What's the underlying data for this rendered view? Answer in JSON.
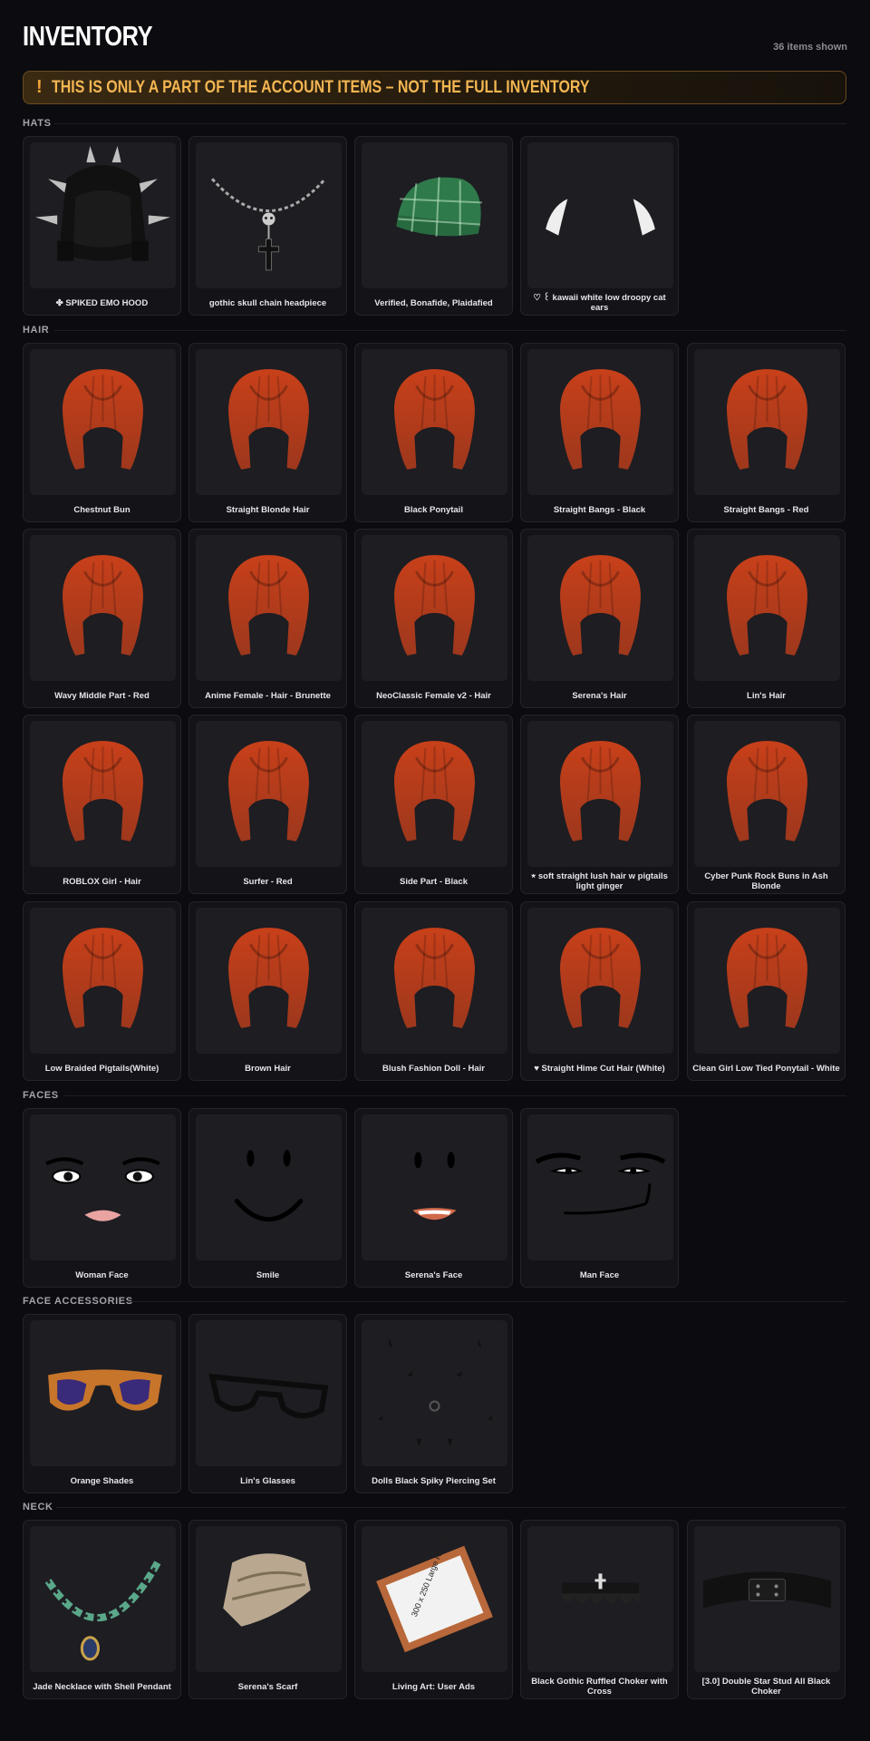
{
  "header": {
    "title": "INVENTORY",
    "count": "36 items shown"
  },
  "banner": {
    "icon": "!",
    "text": "THIS IS ONLY A PART OF THE ACCOUNT ITEMS – NOT THE FULL INVENTORY"
  },
  "sections": {
    "hats": {
      "label": "HATS",
      "items": [
        {
          "name": "✤ SPIKED EMO HOOD",
          "icon": "spiked-hood-icon"
        },
        {
          "name": "gothic skull chain headpiece",
          "icon": "skull-chain-icon"
        },
        {
          "name": "Verified, Bonafide, Plaidafied",
          "icon": "plaid-cap-icon"
        },
        {
          "name": "♡ ꒰ kawaii white low droopy cat ears",
          "icon": "cat-ears-icon"
        }
      ]
    },
    "hair": {
      "label": "HAIR",
      "items": [
        {
          "name": "Chestnut Bun",
          "icon": "hair-icon",
          "color": "#c8401a"
        },
        {
          "name": "Straight Blonde Hair",
          "icon": "hair-icon",
          "color": "#d9b441"
        },
        {
          "name": "Black Ponytail",
          "icon": "hair-icon",
          "color": "#1a1a1e"
        },
        {
          "name": "Straight Bangs - Black",
          "icon": "hair-icon",
          "color": "#2a2a2c"
        },
        {
          "name": "Straight Bangs - Red",
          "icon": "hair-icon",
          "color": "#7a3a22"
        },
        {
          "name": "Wavy Middle Part - Red",
          "icon": "hair-icon",
          "color": "#8a3f22"
        },
        {
          "name": "Anime Female - Hair - Brunette",
          "icon": "hair-icon",
          "color": "#5a2e1a"
        },
        {
          "name": "NeoClassic Female v2 - Hair",
          "icon": "hair-icon",
          "color": "#2a2623"
        },
        {
          "name": "Serena's Hair",
          "icon": "hair-icon",
          "color": "#3a2620"
        },
        {
          "name": "Lin's Hair",
          "icon": "hair-icon",
          "color": "#c05a20"
        },
        {
          "name": "ROBLOX Girl - Hair",
          "icon": "hair-icon",
          "color": "#c0208a"
        },
        {
          "name": "Surfer - Red",
          "icon": "hair-icon",
          "color": "#7a3320"
        },
        {
          "name": "Side Part - Black",
          "icon": "hair-icon",
          "color": "#222226"
        },
        {
          "name": "⭒ soft straight lush hair w pigtails light ginger",
          "icon": "hair-icon",
          "color": "#d8b48a"
        },
        {
          "name": "Cyber Punk Rock Buns in Ash Blonde",
          "icon": "hair-icon",
          "color": "#cfc7bb"
        },
        {
          "name": "Low Braided Pigtails(White)",
          "icon": "hair-icon",
          "color": "#ededed"
        },
        {
          "name": "Brown Hair",
          "icon": "hair-icon",
          "color": "#6a4a24"
        },
        {
          "name": "Blush Fashion Doll - Hair",
          "icon": "hair-icon",
          "color": "#3e2a1e"
        },
        {
          "name": "♥ Straight Hime Cut Hair (White)",
          "icon": "hair-icon",
          "color": "#efefef"
        },
        {
          "name": "Clean Girl Low Tied Ponytail - White",
          "icon": "hair-icon",
          "color": "#e6e6e6"
        }
      ]
    },
    "faces": {
      "label": "FACES",
      "items": [
        {
          "name": "Woman Face",
          "icon": "woman-face-icon"
        },
        {
          "name": "Smile",
          "icon": "smile-face-icon"
        },
        {
          "name": "Serena's Face",
          "icon": "serena-face-icon"
        },
        {
          "name": "Man Face",
          "icon": "man-face-icon"
        }
      ]
    },
    "face_accessories": {
      "label": "FACE ACCESSORIES",
      "items": [
        {
          "name": "Orange Shades",
          "icon": "sunglasses-icon"
        },
        {
          "name": "Lin's Glasses",
          "icon": "glasses-icon"
        },
        {
          "name": "Dolls Black Spiky Piercing Set",
          "icon": "piercings-icon"
        }
      ]
    },
    "neck": {
      "label": "NECK",
      "items": [
        {
          "name": "Jade Necklace with Shell Pendant",
          "icon": "necklace-icon"
        },
        {
          "name": "Serena's Scarf",
          "icon": "scarf-icon"
        },
        {
          "name": "Living Art: User Ads",
          "icon": "framed-art-icon"
        },
        {
          "name": "Black Gothic Ruffled Choker with Cross",
          "icon": "ruffled-choker-icon"
        },
        {
          "name": "[3.0] Double Star Stud All Black Choker",
          "icon": "studded-choker-icon"
        }
      ]
    }
  },
  "art": {
    "frame_text": "300 x 250 Large Rectangle"
  }
}
